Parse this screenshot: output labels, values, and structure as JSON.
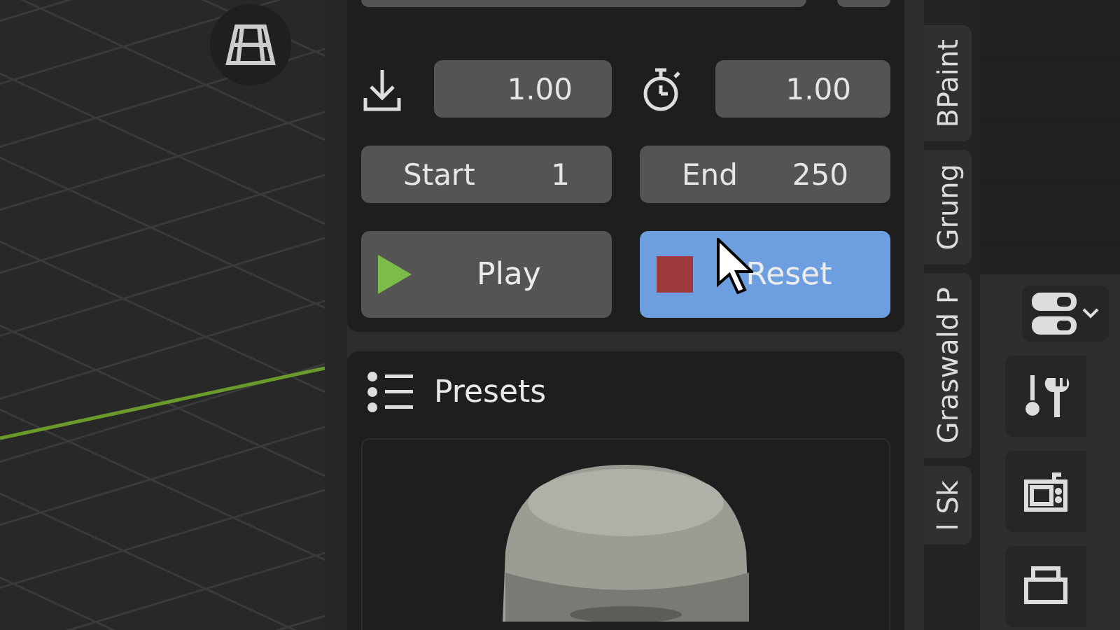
{
  "physics_panel": {
    "fields": [
      {
        "kind": "gravity",
        "value": "1.00"
      },
      {
        "kind": "speed",
        "value": "1.00"
      }
    ],
    "range": [
      {
        "label": "Start",
        "value": "1"
      },
      {
        "label": "End",
        "value": "250"
      }
    ],
    "buttons": [
      {
        "kind": "play",
        "label": "Play",
        "active": false
      },
      {
        "kind": "stop",
        "label": "Reset",
        "active": true
      }
    ]
  },
  "presets_panel": {
    "title": "Presets"
  },
  "sidebar_tabs": [
    {
      "label": "BPaint"
    },
    {
      "label": "Grung"
    },
    {
      "label": "Graswald P"
    },
    {
      "label": "l Sk"
    }
  ]
}
